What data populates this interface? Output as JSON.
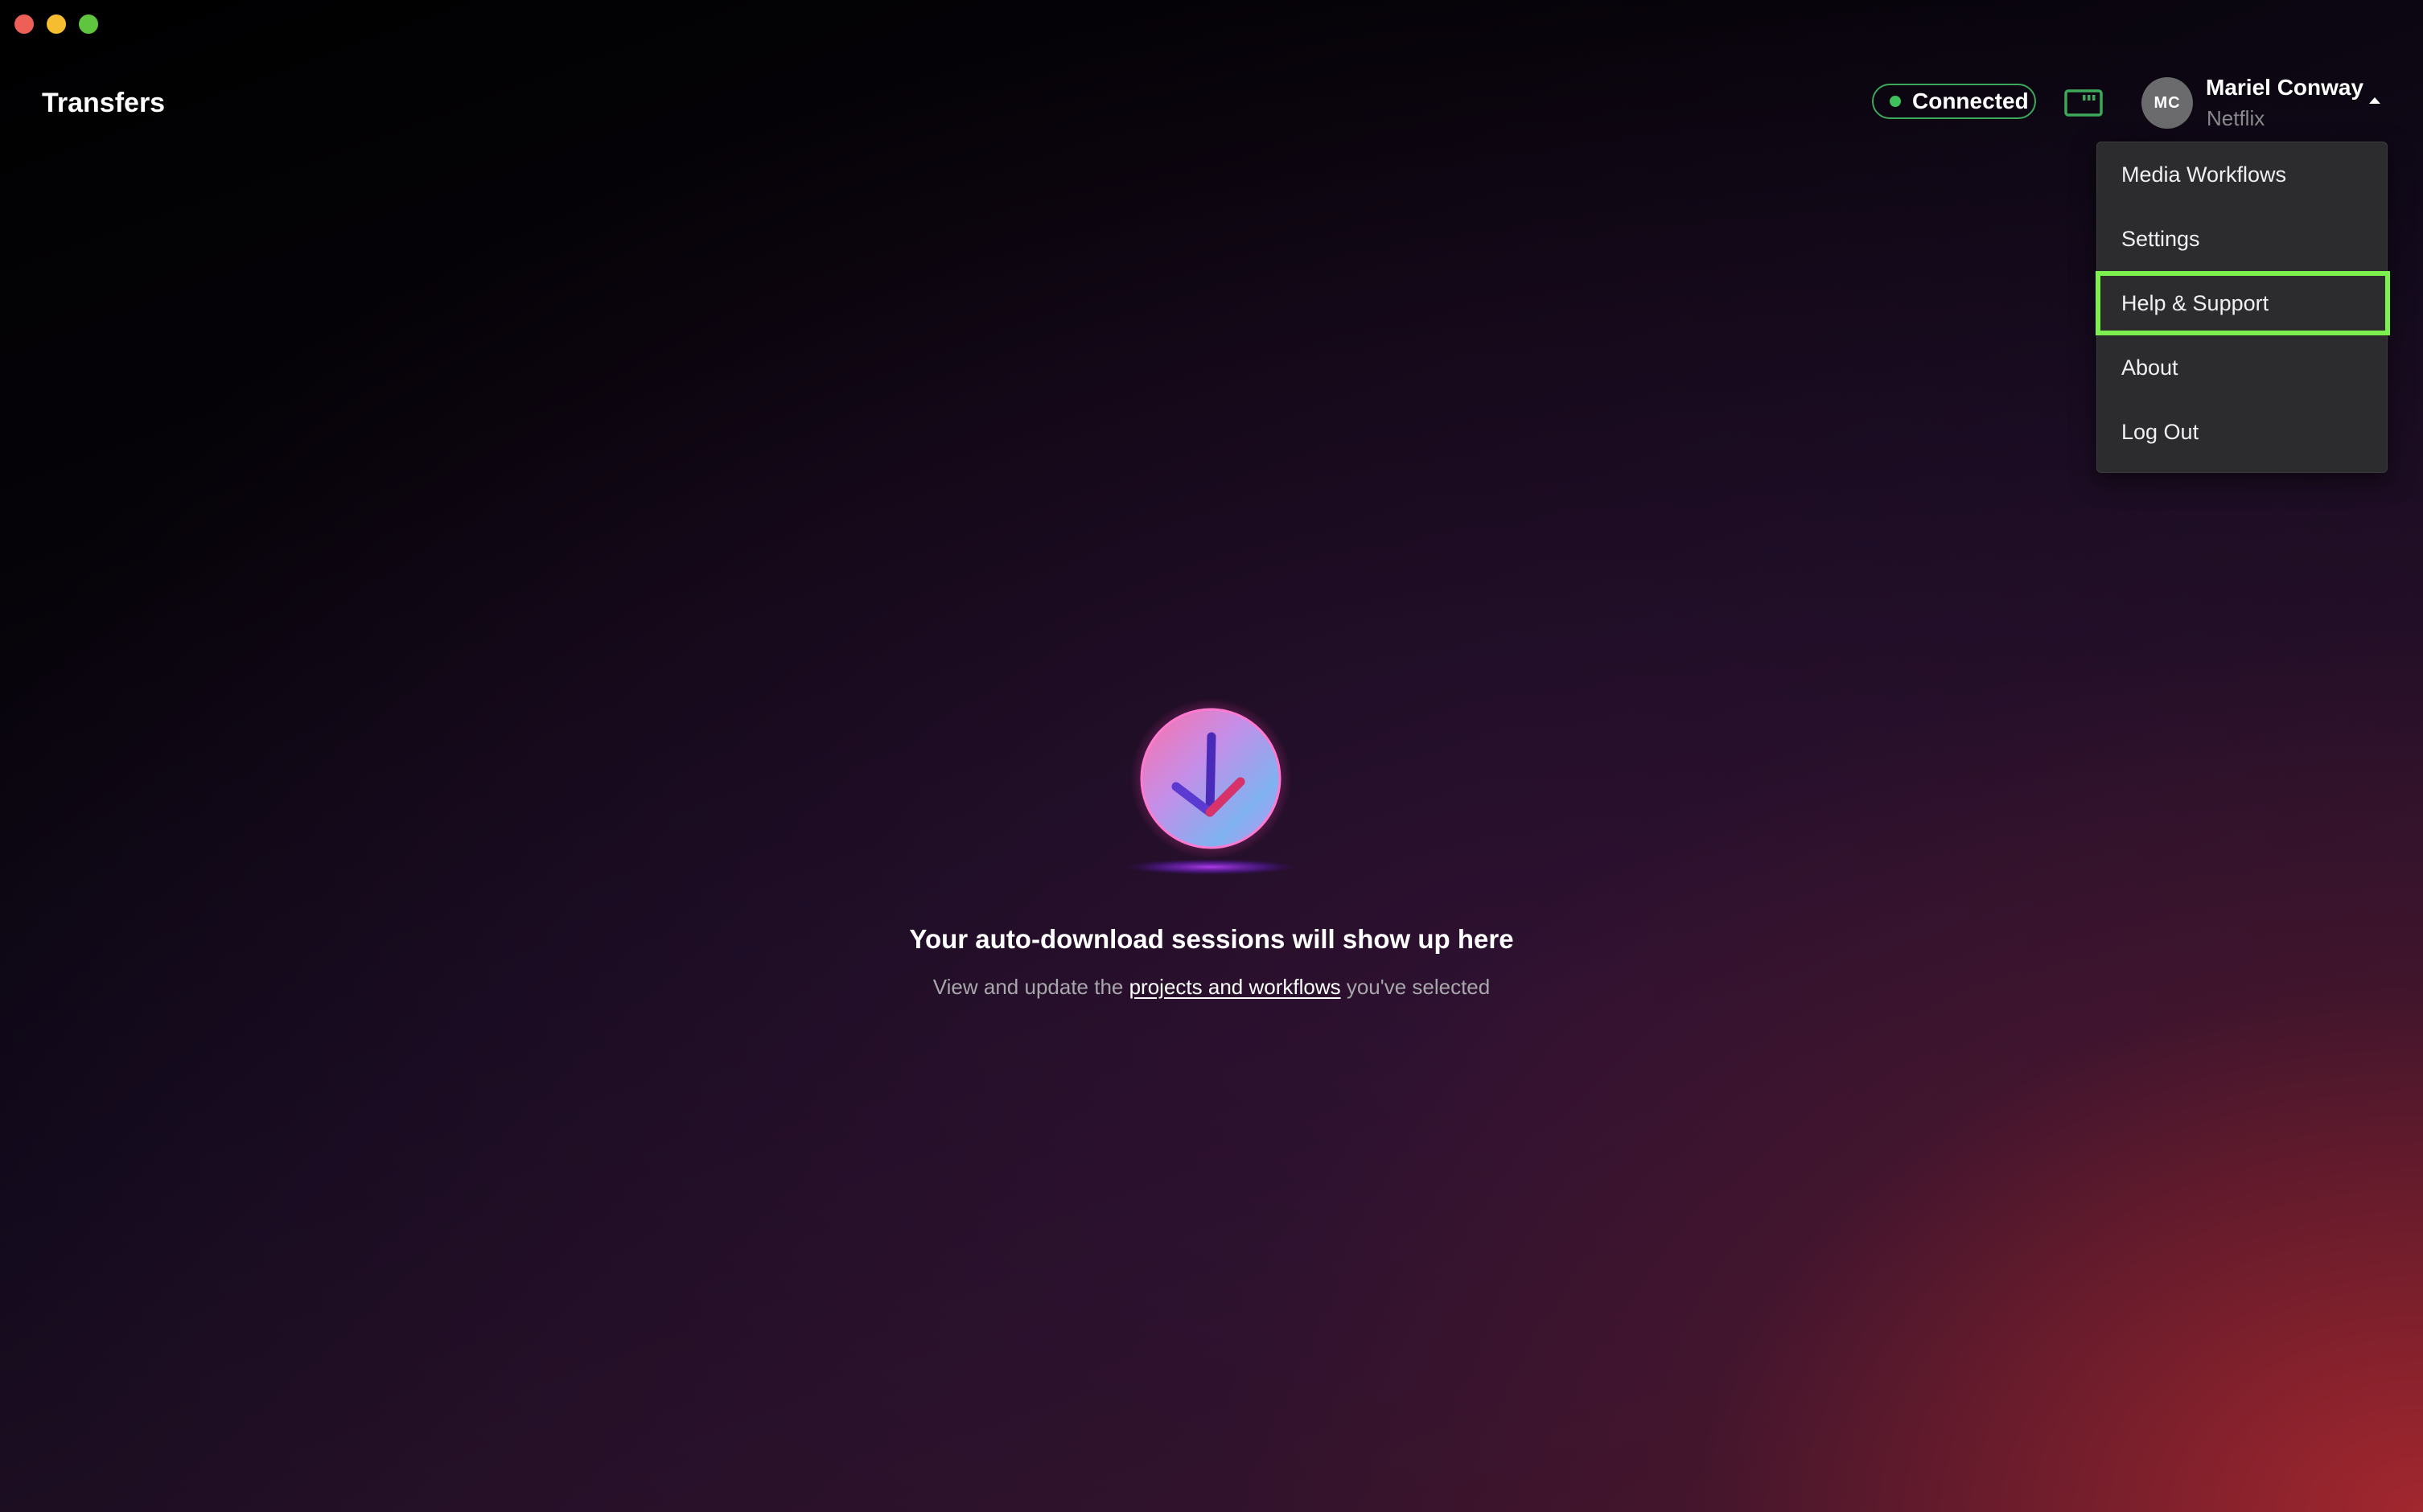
{
  "app": {
    "title": "Transfers"
  },
  "header": {
    "status": {
      "label": "Connected",
      "color": "#3ec05a"
    },
    "card_icon": "card-icon",
    "user": {
      "initials": "MC",
      "name": "Mariel Conway",
      "organization": "Netflix",
      "menu_open": true
    }
  },
  "user_menu": {
    "items": [
      {
        "label": "Media Workflows"
      },
      {
        "label": "Settings"
      },
      {
        "label": "Help & Support",
        "highlighted": true,
        "highlight_color": "#7cf04e"
      },
      {
        "label": "About"
      },
      {
        "label": "Log Out"
      }
    ]
  },
  "empty_state": {
    "icon": "download-arrow-icon",
    "title": "Your auto-download sessions will show up here",
    "subtitle_before": "View and update the ",
    "subtitle_link": "projects and workflows",
    "subtitle_after": " you've selected"
  }
}
